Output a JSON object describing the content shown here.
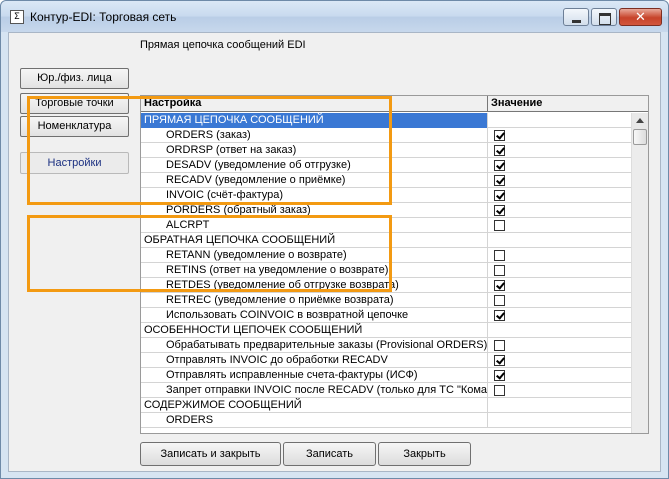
{
  "window": {
    "title": "Контур-EDI: Торговая сеть",
    "icon_glyph": "Σ",
    "close_glyph": "✕"
  },
  "caption": "Прямая цепочка сообщений EDI",
  "nav": {
    "legal": "Юр./физ. лица",
    "outlets": "Торговые точки",
    "nomenclature": "Номенклатура",
    "settings": "Настройки"
  },
  "grid": {
    "col_setting": "Настройка",
    "col_value": "Значение",
    "rows": [
      {
        "label": "ПРЯМАЯ ЦЕПОЧКА СООБЩЕНИЙ",
        "kind": "section",
        "selected": true
      },
      {
        "label": "ORDERS (заказ)",
        "kind": "item",
        "checked": true
      },
      {
        "label": "ORDRSP (ответ на заказ)",
        "kind": "item",
        "checked": true
      },
      {
        "label": "DESADV (уведомление об отгрузке)",
        "kind": "item",
        "checked": true
      },
      {
        "label": "RECADV (уведомление о приёмке)",
        "kind": "item",
        "checked": true
      },
      {
        "label": "INVOIC (счёт-фактура)",
        "kind": "item",
        "checked": true
      },
      {
        "label": "PORDERS (обратный заказ)",
        "kind": "item",
        "checked": true
      },
      {
        "label": "ALCRPT",
        "kind": "item",
        "checked": false
      },
      {
        "label": "ОБРАТНАЯ ЦЕПОЧКА СООБЩЕНИЙ",
        "kind": "section"
      },
      {
        "label": "RETANN (уведомление о возврате)",
        "kind": "item",
        "checked": false
      },
      {
        "label": "RETINS (ответ на уведомление о возврате)",
        "kind": "item",
        "checked": false
      },
      {
        "label": "RETDES (уведомление об отгрузке возврата)",
        "kind": "item",
        "checked": true
      },
      {
        "label": "RETREC (уведомление о приёмке возврата)",
        "kind": "item",
        "checked": false
      },
      {
        "label": "Использовать COINVOIC в возвратной цепочке",
        "kind": "item",
        "checked": true
      },
      {
        "label": "ОСОБЕННОСТИ ЦЕПОЧЕК СООБЩЕНИЙ",
        "kind": "section"
      },
      {
        "label": "Обрабатывать предварительные заказы (Provisional ORDERS)",
        "kind": "item",
        "checked": false
      },
      {
        "label": "Отправлять INVOIC до обработки RECADV",
        "kind": "item",
        "checked": true
      },
      {
        "label": "Отправлять исправленные счета-фактуры (ИСФ)",
        "kind": "item",
        "checked": true
      },
      {
        "label": "Запрет отправки INVOIC после RECADV (только для ТС \"Кома",
        "kind": "item",
        "checked": false
      },
      {
        "label": "СОДЕРЖИМОЕ СООБЩЕНИЙ",
        "kind": "section"
      },
      {
        "label": "ORDERS",
        "kind": "item"
      }
    ]
  },
  "buttons": {
    "save_close": "Записать и закрыть",
    "save": "Записать",
    "close": "Закрыть"
  },
  "colors": {
    "highlight": "#f39a12",
    "selection": "#3a78d4"
  }
}
